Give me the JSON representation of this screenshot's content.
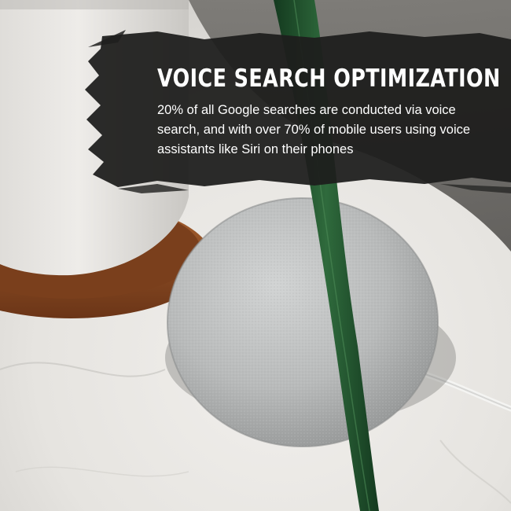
{
  "headline": "VOICE SEARCH OPTIMIZATION",
  "body": "20% of all Google searches are conducted via voice search, and with over 70% of mobile users using voice assistants like Siri on their phones",
  "colors": {
    "banner": "#1e1e1d",
    "text": "#ffffff",
    "marble": "#e8e6e2",
    "speaker": "#b9bbbb",
    "leaf": "#1f4a2a",
    "pot_tray": "#8a4a24"
  },
  "icons": [
    "smart-speaker-image",
    "plant-leaf-image",
    "plant-pot-image",
    "brush-stroke-banner"
  ]
}
